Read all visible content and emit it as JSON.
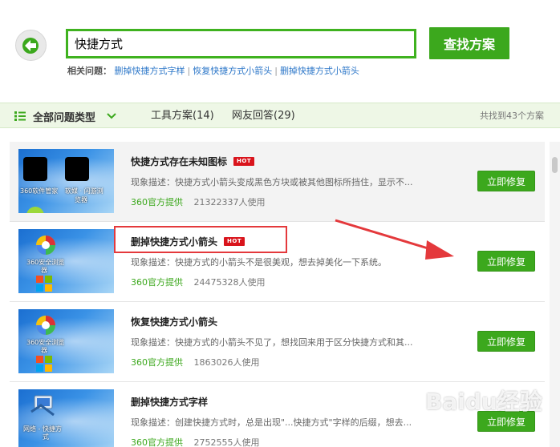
{
  "search": {
    "query": "快捷方式",
    "button_label": "查找方案"
  },
  "related": {
    "label": "相关问题：",
    "links": [
      "删掉快捷方式字样",
      "恢复快捷方式小箭头",
      "删掉快捷方式小箭头"
    ]
  },
  "filter": {
    "all_label": "全部问题类型",
    "tabs": [
      "工具方案(14)",
      "网友回答(29)"
    ],
    "count_text": "共找到43个方案"
  },
  "items": [
    {
      "title": "快捷方式存在未知图标",
      "hot": "HOT",
      "desc": "现象描述：快捷方式小箭头变成黑色方块或被其他图标所挡住，显示不...",
      "source": "360官方提供",
      "users": "21322337人使用",
      "fix_label": "立即修复",
      "thumb_captions": [
        "360软件管家",
        "软媒 · 闪游浏",
        "览器"
      ]
    },
    {
      "title": "删掉快捷方式小箭头",
      "hot": "HOT",
      "desc": "现象描述：快捷方式的小箭头不是很美观，想去掉美化一下系统。",
      "source": "360官方提供",
      "users": "24475328人使用",
      "fix_label": "立即修复",
      "thumb_captions": [
        "360安全浏览",
        "器"
      ]
    },
    {
      "title": "恢复快捷方式小箭头",
      "desc": "现象描述：快捷方式的小箭头不见了，想找回来用于区分快捷方式和其...",
      "source": "360官方提供",
      "users": "1863026人使用",
      "fix_label": "立即修复",
      "thumb_captions": [
        "360安全浏览",
        "器"
      ]
    },
    {
      "title": "删掉快捷方式字样",
      "desc": "现象描述：创建快捷方式时，总是出现\"...快捷方式\"字样的后缀，想去...",
      "source": "360官方提供",
      "users": "2752555人使用",
      "fix_label": "立即修复",
      "thumb_captions": [
        "网络 - 快捷方",
        "式"
      ]
    }
  ],
  "watermark": "Baidu经验",
  "colors": {
    "accent_green": "#3ca81d",
    "link_blue": "#2b76c8",
    "hot_red": "#d9141c",
    "annotation_red": "#e4393c"
  }
}
